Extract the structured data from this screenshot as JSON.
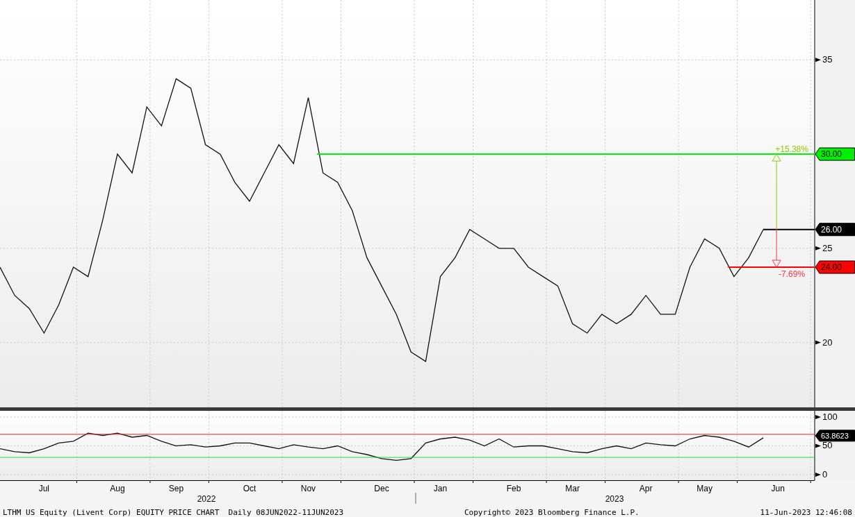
{
  "price_chart": {
    "chart_data": {
      "type": "line",
      "categories": [
        null,
        null,
        null,
        "Jul",
        null,
        null,
        null,
        null,
        "Aug",
        null,
        null,
        null,
        "Sep",
        null,
        null,
        null,
        null,
        "Oct",
        null,
        null,
        null,
        "Nov",
        null,
        null,
        null,
        null,
        "Dec",
        null,
        null,
        null,
        "Jan",
        null,
        null,
        null,
        null,
        "Feb",
        null,
        null,
        null,
        "Mar",
        null,
        null,
        null,
        null,
        "Apr",
        null,
        null,
        null,
        "May",
        null,
        null,
        null,
        null,
        "Jun"
      ],
      "series": [
        {
          "color": "#111111",
          "values": [
            24,
            22.5,
            21.8,
            20.5,
            22,
            24,
            23.5,
            26.5,
            30,
            29,
            32.5,
            31.5,
            34,
            33.5,
            30.5,
            30,
            28.5,
            27.5,
            29,
            30.5,
            29.5,
            33,
            29,
            28.5,
            27,
            24.5,
            23,
            21.5,
            19.5,
            19,
            23.5,
            24.5,
            26,
            25.5,
            25,
            25,
            24,
            23.5,
            23,
            21,
            20.5,
            21.5,
            21,
            21.5,
            22.5,
            21.5,
            21.5,
            24,
            25.5,
            25,
            23.5,
            24.5,
            26,
            null
          ]
        }
      ],
      "ylim": [
        16.56,
        38.18
      ],
      "yticks": [
        20,
        25,
        35
      ],
      "grid": true,
      "ref_lines": [
        {
          "value": 30,
          "axis": "y",
          "label": "30.00",
          "color": "#00ee00"
        },
        {
          "value": 26,
          "axis": "y",
          "label": "26.00",
          "color": "#000000"
        },
        {
          "value": 24,
          "axis": "y",
          "label": "24.00",
          "color": "#ff0000"
        }
      ]
    },
    "measure": {
      "up_label": "+15.38%",
      "down_label": "-7.69%"
    }
  },
  "rsi_chart": {
    "chart_data": {
      "type": "line",
      "categories": [
        null,
        null,
        null,
        null,
        null,
        null,
        null,
        null,
        null,
        null,
        null,
        null,
        null,
        null,
        null,
        null,
        null,
        null,
        null,
        null,
        null,
        null,
        null,
        null,
        null,
        null,
        null,
        null,
        null,
        null,
        null,
        null,
        null,
        null,
        null,
        null,
        null,
        null,
        null,
        null,
        null,
        null,
        null,
        null,
        null,
        null,
        null,
        null,
        null,
        null,
        null,
        null,
        null
      ],
      "series": [
        {
          "color": "#111111",
          "values": [
            45,
            40,
            38,
            45,
            55,
            58,
            72,
            68,
            72,
            65,
            68,
            58,
            50,
            52,
            48,
            50,
            55,
            55,
            50,
            45,
            52,
            48,
            45,
            50,
            40,
            35,
            28,
            25,
            28,
            55,
            62,
            65,
            60,
            50,
            62,
            48,
            50,
            50,
            45,
            40,
            38,
            45,
            50,
            45,
            55,
            52,
            50,
            62,
            68,
            65,
            58,
            48,
            64
          ]
        }
      ],
      "ylim": [
        -9.6,
        110.8
      ],
      "yticks": [
        0,
        50,
        100
      ],
      "grid": true,
      "ref_lines": [
        {
          "value": 70,
          "axis": "y",
          "color": "#dd2222"
        },
        {
          "value": 30,
          "axis": "y",
          "color": "#22dd22"
        }
      ]
    },
    "last_value_tag": "63.8623"
  },
  "x_axis": {
    "years": [
      "2022",
      "2023"
    ]
  },
  "footer": {
    "title": "LTHM US Equity (Livent Corp) EQUITY PRICE CHART  Daily 08JUN2022-11JUN2023",
    "copyright": "Copyright© 2023 Bloomberg Finance L.P.",
    "timestamp": "11-Jun-2023 12:46:08"
  }
}
